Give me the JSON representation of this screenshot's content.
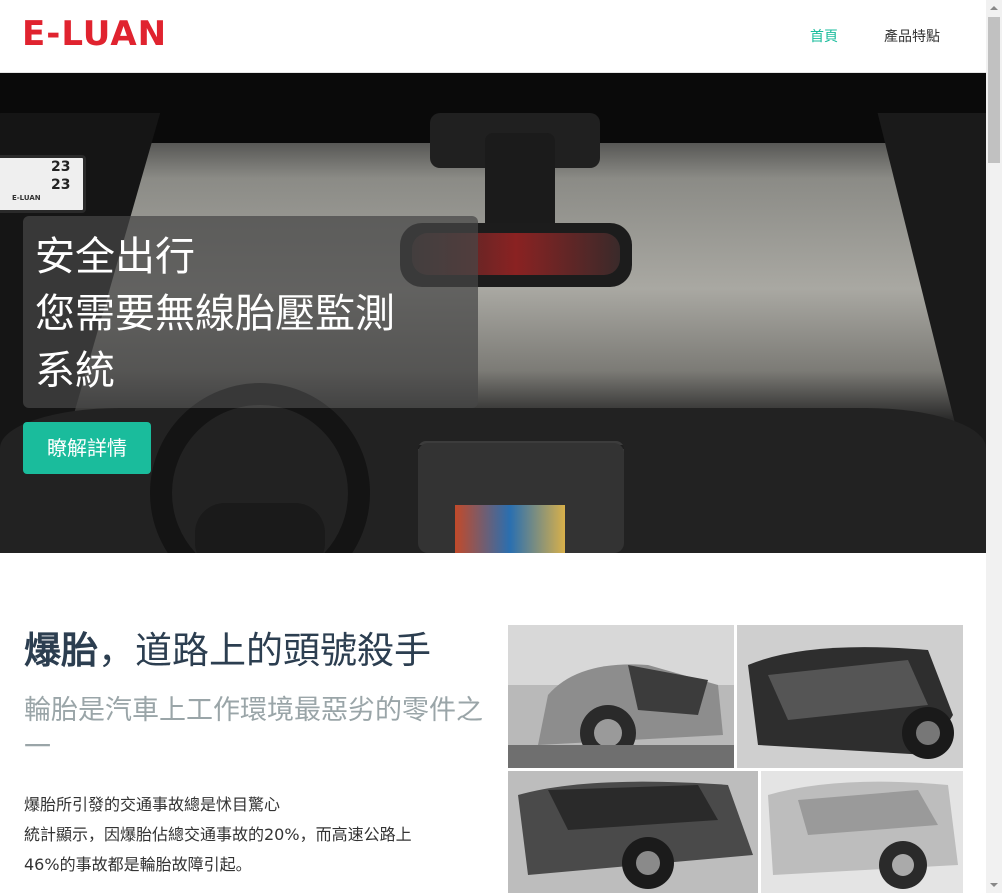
{
  "brand": {
    "logo": "E-LUAN",
    "color": "#e0232f"
  },
  "nav": {
    "items": [
      {
        "label": "首頁",
        "active": true
      },
      {
        "label": "產品特點",
        "active": false
      }
    ],
    "accent": "#1abc9c"
  },
  "hero": {
    "device": {
      "value1": "23",
      "value2": "23",
      "brand": "E-LUAN"
    },
    "caption_lines": [
      "安全出行",
      "您需要無線胎壓監測",
      "系統"
    ],
    "button": "瞭解詳情"
  },
  "section": {
    "title_bold": "爆胎",
    "title_rest": "，道路上的頭號殺手",
    "subtitle": "輪胎是汽車上工作環境最惡劣的零件之一",
    "body_lines": [
      "爆胎所引發的交通事故總是怵目驚心",
      "統計顯示，因爆胎佔總交通事故的20%，而高速公路上",
      "46%的事故都是輪胎故障引起。"
    ],
    "image_alt": "damaged-cars-collage"
  }
}
